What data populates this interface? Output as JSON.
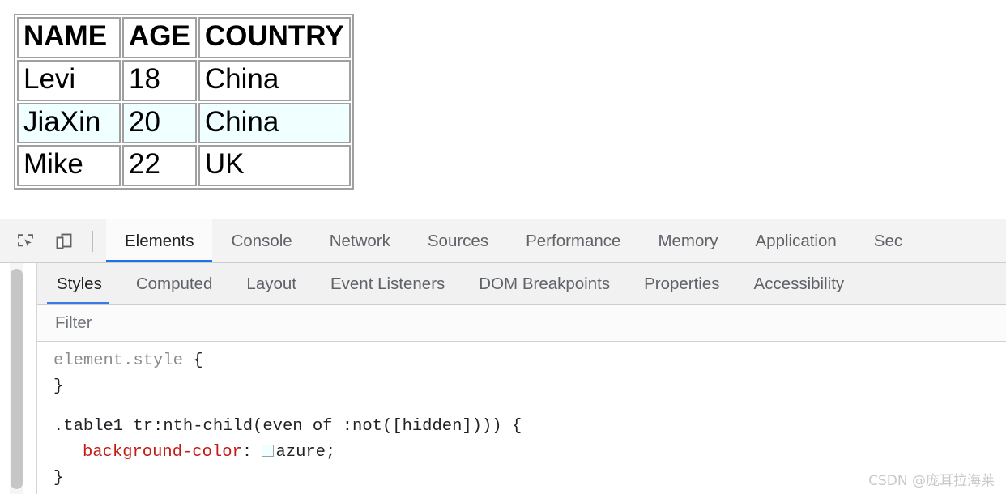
{
  "page": {
    "table": {
      "columns": [
        "NAME",
        "AGE",
        "COUNTRY"
      ],
      "rows": [
        {
          "name": "Levi",
          "age": "18",
          "country": "China",
          "highlighted": false
        },
        {
          "name": "JiaXin",
          "age": "20",
          "country": "China",
          "highlighted": true
        },
        {
          "name": "Mike",
          "age": "22",
          "country": "UK",
          "highlighted": false
        }
      ],
      "even_row_background": "#f0ffff"
    }
  },
  "devtools": {
    "toolbar_icons": [
      {
        "name": "inspect-element-icon",
        "title": "Inspect element"
      },
      {
        "name": "device-toolbar-icon",
        "title": "Toggle device toolbar"
      }
    ],
    "main_tabs": [
      {
        "label": "Elements",
        "active": true
      },
      {
        "label": "Console",
        "active": false
      },
      {
        "label": "Network",
        "active": false
      },
      {
        "label": "Sources",
        "active": false
      },
      {
        "label": "Performance",
        "active": false
      },
      {
        "label": "Memory",
        "active": false
      },
      {
        "label": "Application",
        "active": false
      },
      {
        "label": "Sec",
        "active": false
      }
    ],
    "sub_tabs": [
      {
        "label": "Styles",
        "active": true
      },
      {
        "label": "Computed",
        "active": false
      },
      {
        "label": "Layout",
        "active": false
      },
      {
        "label": "Event Listeners",
        "active": false
      },
      {
        "label": "DOM Breakpoints",
        "active": false
      },
      {
        "label": "Properties",
        "active": false
      },
      {
        "label": "Accessibility",
        "active": false
      }
    ],
    "filter": {
      "placeholder": "Filter",
      "value": ""
    },
    "rules": [
      {
        "selector": "element.style",
        "selector_muted": true,
        "open_brace": "{",
        "close_brace": "}",
        "declarations": []
      },
      {
        "selector": ".table1 tr:nth-child(even of :not([hidden])))",
        "selector_muted": false,
        "open_brace": "{",
        "close_brace": "}",
        "declarations": [
          {
            "property": "background-color",
            "separator": ":",
            "value": "azure",
            "terminator": ";",
            "swatch_color": "#f0ffff"
          }
        ]
      }
    ],
    "accent_color": "#1a73e8"
  },
  "watermark": {
    "text": "CSDN @庞耳拉海莱"
  }
}
